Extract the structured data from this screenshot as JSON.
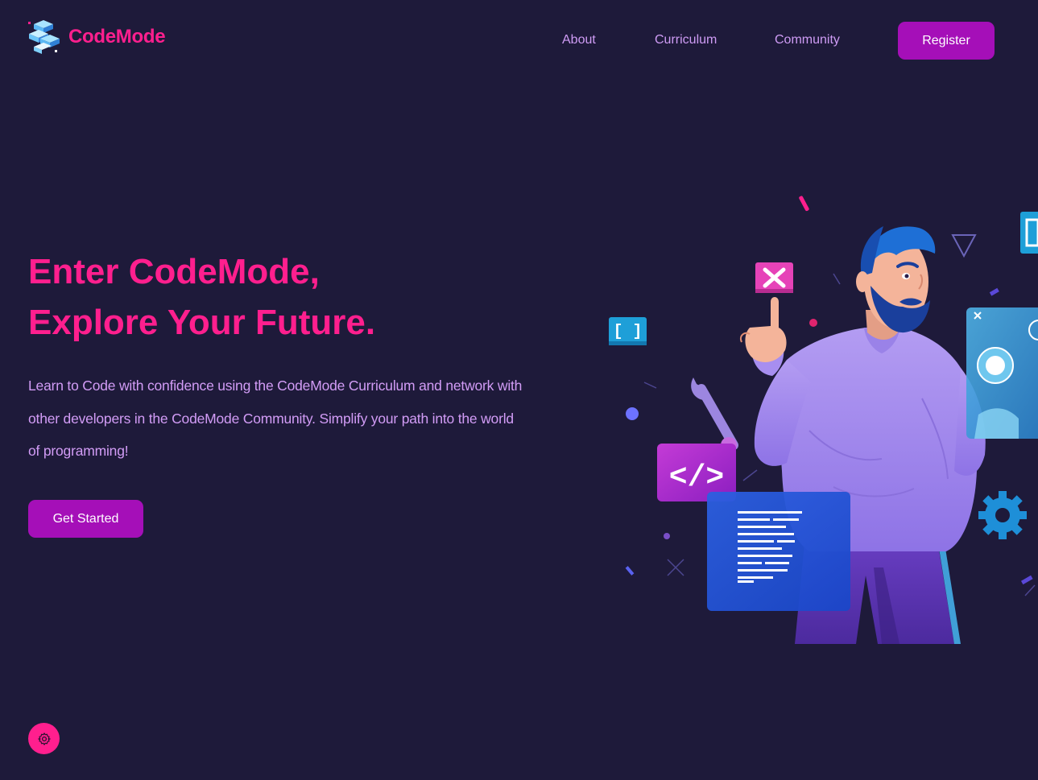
{
  "brand": {
    "name": "CodeMode",
    "logo_icon": "stacked-cubes-icon",
    "color": "#ff1f8e"
  },
  "nav": {
    "items": [
      {
        "label": "About"
      },
      {
        "label": "Curriculum"
      },
      {
        "label": "Community"
      }
    ],
    "register_label": "Register"
  },
  "hero": {
    "title_line1": "Enter CodeMode,",
    "title_line2": "Explore Your Future.",
    "description": "Learn to Code with confidence using the CodeMode Curriculum and network with other developers in the CodeMode Community. Simplify your path into the world of programming!",
    "cta_label": "Get Started"
  },
  "illustration": {
    "subject": "developer-illustration",
    "badges": {
      "brackets": "[ ]",
      "code_tag": "</>"
    }
  },
  "settings": {
    "icon": "gear-icon"
  },
  "colors": {
    "background": "#1e1a3a",
    "accent_pink": "#ff1f8e",
    "button_purple": "#a50fb8",
    "text_lavender": "#d29cf6"
  }
}
